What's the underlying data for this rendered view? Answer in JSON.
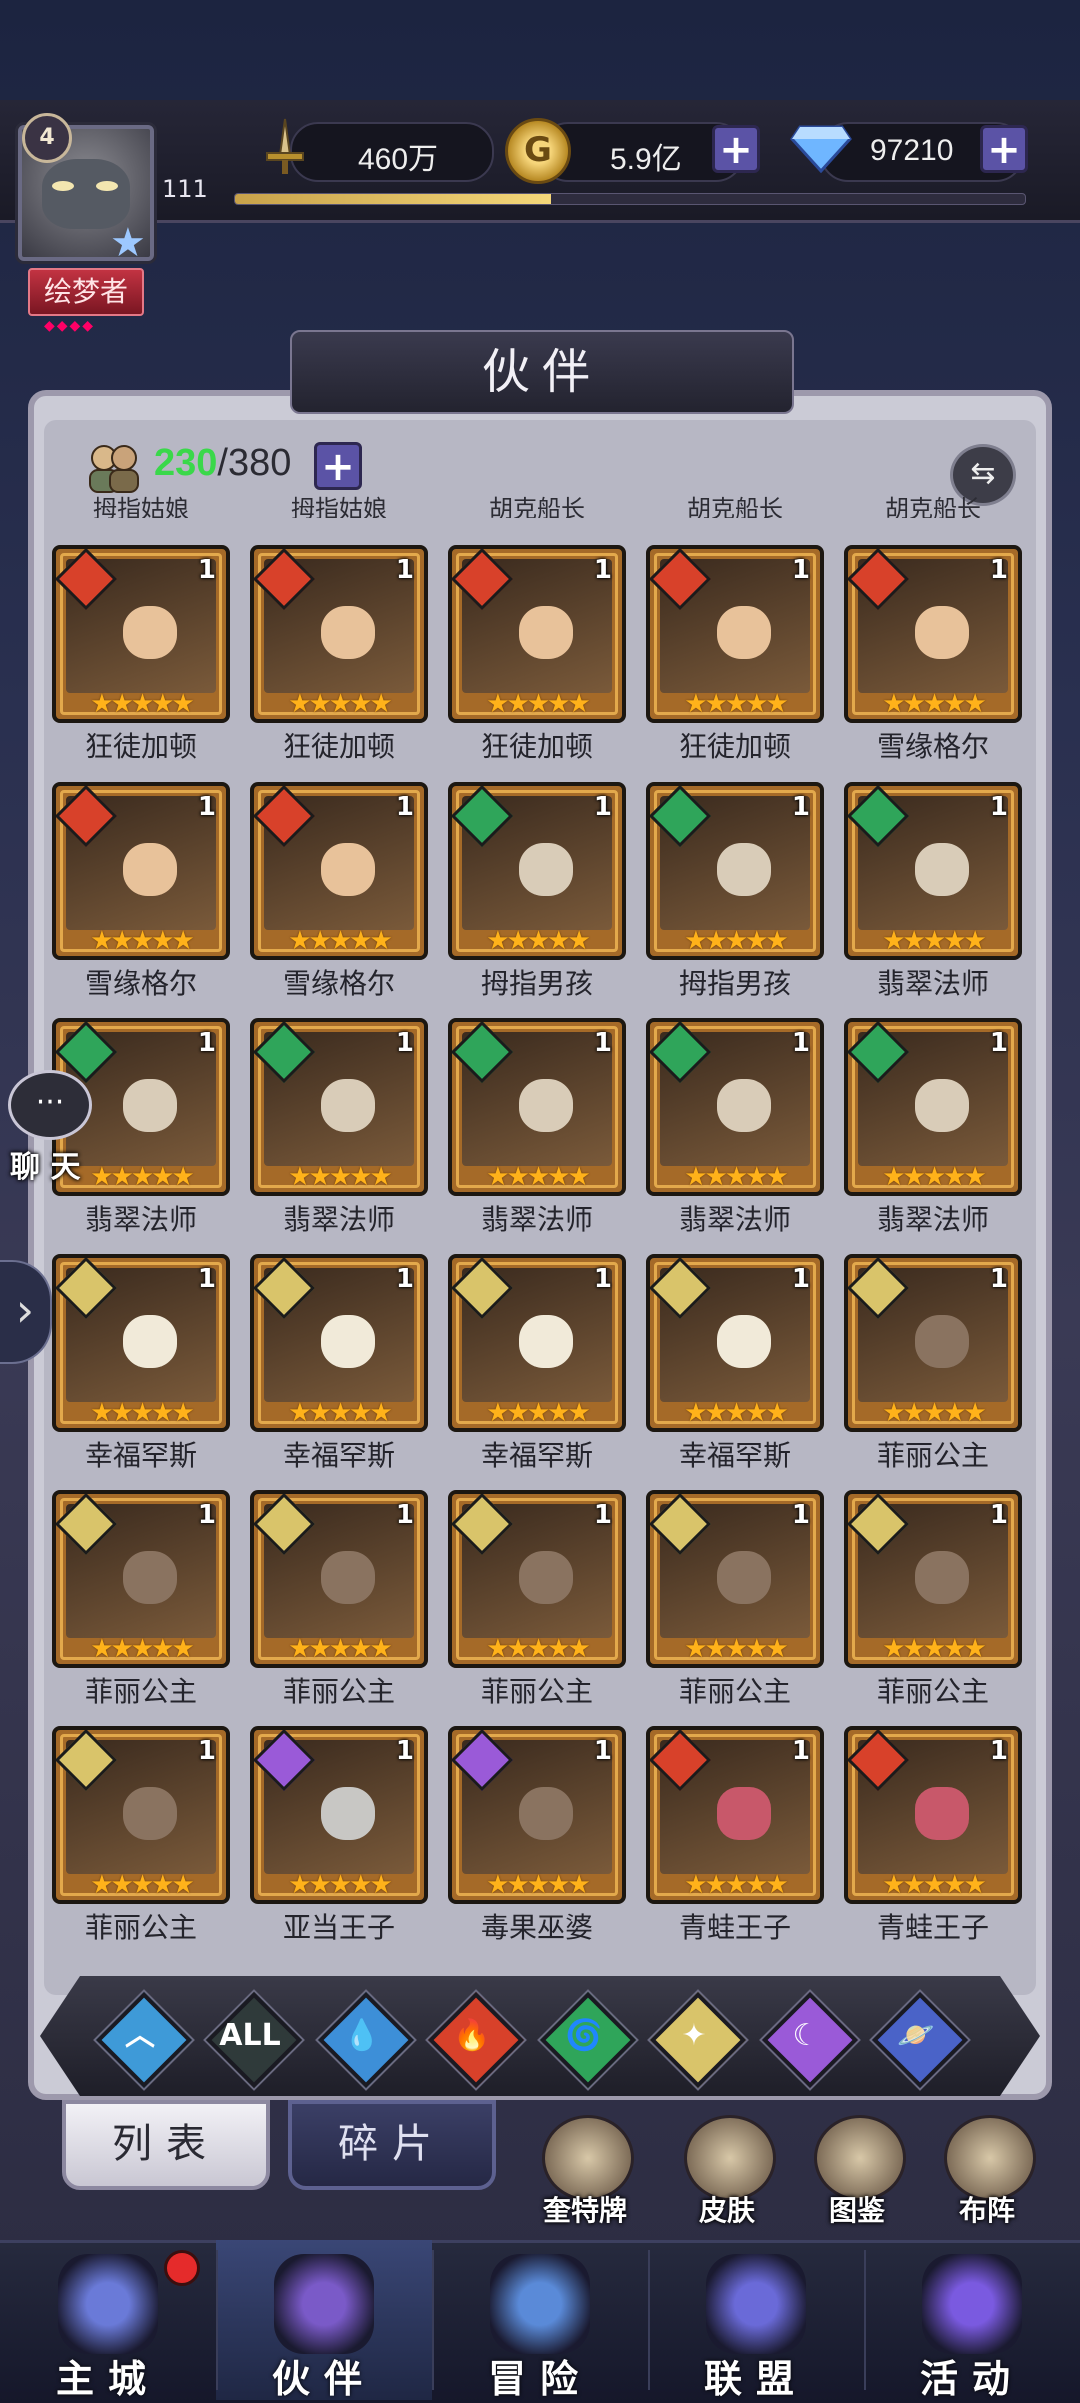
{
  "player": {
    "avatar_level": "4",
    "level": "111",
    "title": "绘梦者",
    "exp_fraction": 0.4
  },
  "resources": {
    "power": "460万",
    "gold": "5.9亿",
    "gems": "97210"
  },
  "panel": {
    "title": "伙伴",
    "count_current": "230",
    "count_sep_max": "/380",
    "top_clipped_names": [
      "拇指姑娘",
      "拇指姑娘",
      "胡克船长",
      "胡克船长",
      "胡克船长"
    ]
  },
  "colors": {
    "fire": "#d8412a",
    "wind": "#2fa55a",
    "light": "#d9c46a",
    "dark": "#9a5ad8",
    "water": "#3d8fd8"
  },
  "partners": [
    {
      "name": "狂徒加顿",
      "element": "fire",
      "level": "1",
      "stars": 5,
      "face": "warm"
    },
    {
      "name": "狂徒加顿",
      "element": "fire",
      "level": "1",
      "stars": 5,
      "face": "warm"
    },
    {
      "name": "狂徒加顿",
      "element": "fire",
      "level": "1",
      "stars": 5,
      "face": "warm"
    },
    {
      "name": "狂徒加顿",
      "element": "fire",
      "level": "1",
      "stars": 5,
      "face": "warm"
    },
    {
      "name": "雪缘格尔",
      "element": "fire",
      "level": "1",
      "stars": 5,
      "face": "warm"
    },
    {
      "name": "雪缘格尔",
      "element": "fire",
      "level": "1",
      "stars": 5,
      "face": "warm"
    },
    {
      "name": "雪缘格尔",
      "element": "fire",
      "level": "1",
      "stars": 5,
      "face": "warm"
    },
    {
      "name": "拇指男孩",
      "element": "wind",
      "level": "1",
      "stars": 5,
      "face": "green"
    },
    {
      "name": "拇指男孩",
      "element": "wind",
      "level": "1",
      "stars": 5,
      "face": "green"
    },
    {
      "name": "翡翠法师",
      "element": "wind",
      "level": "1",
      "stars": 5,
      "face": "green"
    },
    {
      "name": "翡翠法师",
      "element": "wind",
      "level": "1",
      "stars": 5,
      "face": "green"
    },
    {
      "name": "翡翠法师",
      "element": "wind",
      "level": "1",
      "stars": 5,
      "face": "green"
    },
    {
      "name": "翡翠法师",
      "element": "wind",
      "level": "1",
      "stars": 5,
      "face": "green"
    },
    {
      "name": "翡翠法师",
      "element": "wind",
      "level": "1",
      "stars": 5,
      "face": "green"
    },
    {
      "name": "翡翠法师",
      "element": "wind",
      "level": "1",
      "stars": 5,
      "face": "green"
    },
    {
      "name": "幸福罕斯",
      "element": "light",
      "level": "1",
      "stars": 5,
      "face": "pale"
    },
    {
      "name": "幸福罕斯",
      "element": "light",
      "level": "1",
      "stars": 5,
      "face": "pale"
    },
    {
      "name": "幸福罕斯",
      "element": "light",
      "level": "1",
      "stars": 5,
      "face": "pale"
    },
    {
      "name": "幸福罕斯",
      "element": "light",
      "level": "1",
      "stars": 5,
      "face": "pale"
    },
    {
      "name": "菲丽公主",
      "element": "light",
      "level": "1",
      "stars": 5,
      "face": "dark"
    },
    {
      "name": "菲丽公主",
      "element": "light",
      "level": "1",
      "stars": 5,
      "face": "dark"
    },
    {
      "name": "菲丽公主",
      "element": "light",
      "level": "1",
      "stars": 5,
      "face": "dark"
    },
    {
      "name": "菲丽公主",
      "element": "light",
      "level": "1",
      "stars": 5,
      "face": "dark"
    },
    {
      "name": "菲丽公主",
      "element": "light",
      "level": "1",
      "stars": 5,
      "face": "dark"
    },
    {
      "name": "菲丽公主",
      "element": "light",
      "level": "1",
      "stars": 5,
      "face": "dark"
    },
    {
      "name": "菲丽公主",
      "element": "light",
      "level": "1",
      "stars": 5,
      "face": "dark"
    },
    {
      "name": "亚当王子",
      "element": "dark",
      "level": "1",
      "stars": 5,
      "face": "gray"
    },
    {
      "name": "毒果巫婆",
      "element": "dark",
      "level": "1",
      "stars": 5,
      "face": "dark"
    },
    {
      "name": "青蛙王子",
      "element": "fire",
      "level": "1",
      "stars": 5,
      "face": "frog"
    },
    {
      "name": "青蛙王子",
      "element": "fire",
      "level": "1",
      "stars": 5,
      "face": "frog"
    }
  ],
  "filters": [
    {
      "name": "all-elements",
      "color": "#3e9ad8",
      "glyph": "︿"
    },
    {
      "name": "all",
      "color": "#2f3a3a",
      "glyph": "ALL"
    },
    {
      "name": "water",
      "color": "#3d8fd8",
      "glyph": "💧"
    },
    {
      "name": "fire",
      "color": "#d8412a",
      "glyph": "🔥"
    },
    {
      "name": "wind",
      "color": "#2fa55a",
      "glyph": "🌀"
    },
    {
      "name": "light",
      "color": "#d9c46a",
      "glyph": "✦"
    },
    {
      "name": "dark",
      "color": "#9a5ad8",
      "glyph": "☾"
    },
    {
      "name": "cosmic",
      "color": "#4a63c8",
      "glyph": "🪐"
    }
  ],
  "chat": {
    "glyph": "···",
    "label": "聊 天"
  },
  "tabs": {
    "list": "列表",
    "fragments": "碎片"
  },
  "shortcuts": [
    "奎特牌",
    "皮肤",
    "图鉴",
    "布阵"
  ],
  "nav": [
    "主城",
    "伙伴",
    "冒险",
    "联盟",
    "活动"
  ]
}
